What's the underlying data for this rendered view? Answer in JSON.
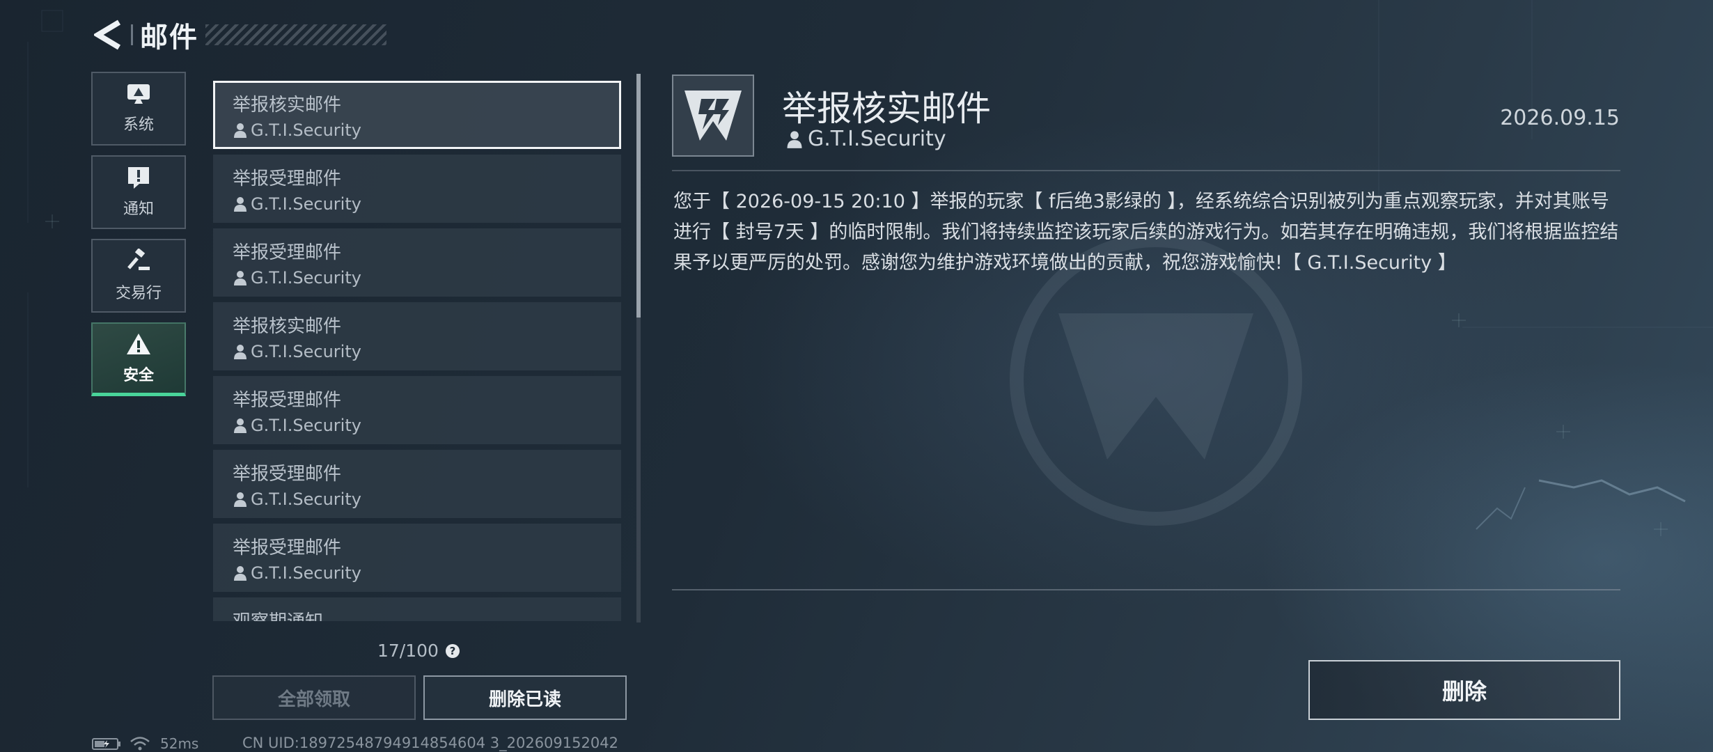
{
  "header": {
    "title": "邮件"
  },
  "categories": [
    {
      "label": "系统",
      "icon": "monitor-icon",
      "active": false
    },
    {
      "label": "通知",
      "icon": "exclamation-icon",
      "active": false
    },
    {
      "label": "交易行",
      "icon": "gavel-icon",
      "active": false
    },
    {
      "label": "安全",
      "icon": "warning-icon",
      "active": true
    }
  ],
  "mail_list": [
    {
      "subject": "举报核实邮件",
      "sender": "G.T.I.Security",
      "selected": true
    },
    {
      "subject": "举报受理邮件",
      "sender": "G.T.I.Security"
    },
    {
      "subject": "举报受理邮件",
      "sender": "G.T.I.Security"
    },
    {
      "subject": "举报核实邮件",
      "sender": "G.T.I.Security"
    },
    {
      "subject": "举报受理邮件",
      "sender": "G.T.I.Security"
    },
    {
      "subject": "举报受理邮件",
      "sender": "G.T.I.Security"
    },
    {
      "subject": "举报受理邮件",
      "sender": "G.T.I.Security"
    },
    {
      "subject": "观察期通知",
      "sender": ""
    }
  ],
  "list_footer": {
    "count": "17/100",
    "help": "?",
    "claim_all": "全部领取",
    "delete_read": "删除已读"
  },
  "status_bar": {
    "ping": "52ms",
    "uid": "CN UID:18972548794914854604 3_202609152042"
  },
  "detail": {
    "title": "举报核实邮件",
    "sender": "G.T.I.Security",
    "date": "2026.09.15",
    "body": "您于【 2026-09-15 20:10 】举报的玩家【 f后绝3影绿的 】，经系统综合识别被列为重点观察玩家，并对其账号进行【 封号7天 】的临时限制。我们将持续监控该玩家后续的游戏行为。如若其存在明确违规，我们将根据监控结果予以更严厉的处罚。感谢您为维护游戏环境做出的贡献，祝您游戏愉快!【 G.T.I.Security 】",
    "delete_label": "删除"
  },
  "colors": {
    "accent_green": "#49d49a",
    "selected_border": "#f2f4f6"
  }
}
